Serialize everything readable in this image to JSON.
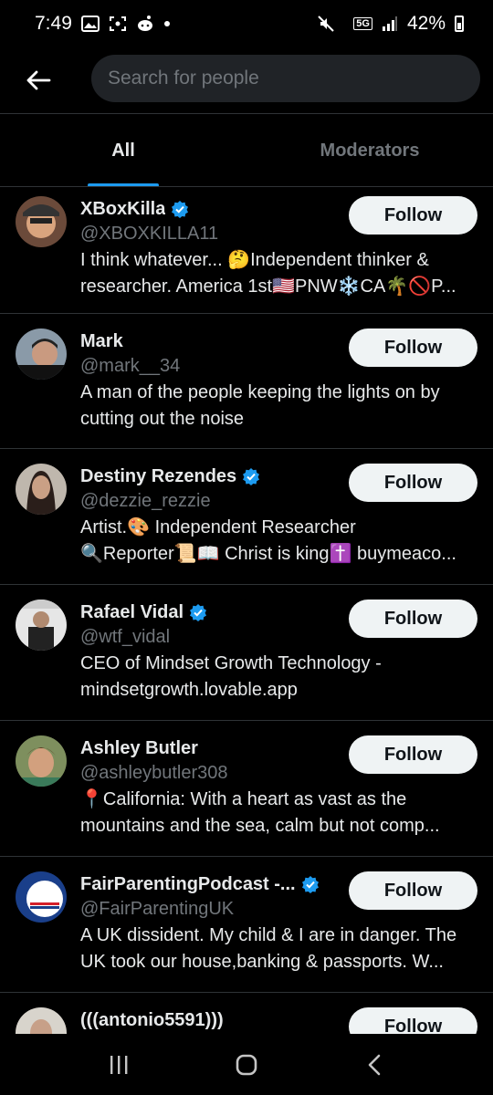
{
  "status": {
    "time": "7:49",
    "network": "5G",
    "battery": "42%"
  },
  "header": {
    "search_placeholder": "Search for people"
  },
  "tabs": [
    {
      "label": "All",
      "active": true
    },
    {
      "label": "Moderators",
      "active": false
    }
  ],
  "people": [
    {
      "name": "XBoxKilla",
      "verified": true,
      "handle": "@XBOXKILLA11",
      "bio1": "I think whatever... 🤔Independent thinker &",
      "bio2": "researcher. America 1st🇺🇸PNW❄️CA🌴🚫P...",
      "follow": "Follow"
    },
    {
      "name": "Mark",
      "verified": false,
      "handle": "@mark__34",
      "bio1": "A man of the people keeping the lights on by",
      "bio2": "cutting out the noise",
      "follow": "Follow"
    },
    {
      "name": "Destiny Rezendes",
      "verified": true,
      "handle": "@dezzie_rezzie",
      "bio1": "Artist.🎨 Independent Researcher",
      "bio2": "🔍Reporter📜📖 Christ is king✝️ buymeaco...",
      "follow": "Follow"
    },
    {
      "name": "Rafael Vidal",
      "verified": true,
      "handle": "@wtf_vidal",
      "bio1": "CEO of Mindset Growth Technology -",
      "bio2": "mindsetgrowth.lovable.app",
      "follow": "Follow"
    },
    {
      "name": "Ashley Butler",
      "verified": false,
      "handle": "@ashleybutler308",
      "bio1": "📍California: With a heart as vast as the",
      "bio2": "mountains and the sea, calm but not comp...",
      "follow": "Follow"
    },
    {
      "name": "FairParentingPodcast -...",
      "verified": true,
      "handle": "@FairParentingUK",
      "bio1": "A UK dissident. My child & I are in danger. The",
      "bio2": "UK took our house,banking & passports. W...",
      "follow": "Follow"
    },
    {
      "name": "(((antonio5591)))",
      "verified": false,
      "handle": "",
      "bio1": "",
      "bio2": "",
      "follow": "Follow"
    }
  ],
  "colors": {
    "accent": "#1d9bf0",
    "background": "#000000",
    "secondary_text": "#71767b"
  }
}
